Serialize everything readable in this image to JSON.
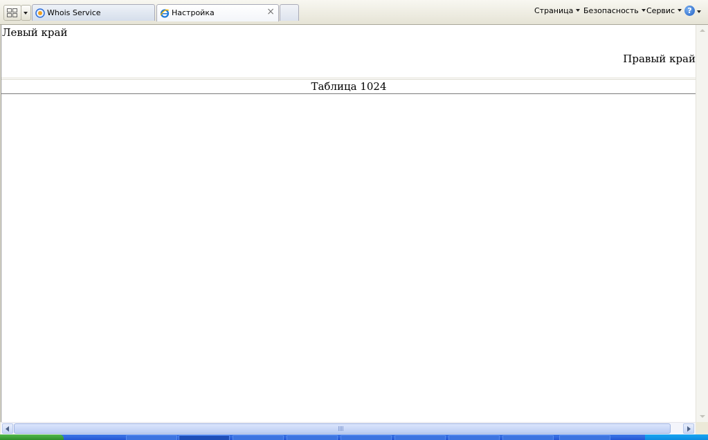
{
  "tabs": [
    {
      "label": "Whois Service",
      "icon": "whois-favicon"
    },
    {
      "label": "Настройка",
      "icon": "ie-favicon",
      "close": "×"
    }
  ],
  "command_bar": {
    "page": "Страница",
    "security": "Безопасность",
    "tools": "Сервис",
    "help": "?"
  },
  "content": {
    "left_edge": "Левый край",
    "right_edge": "Правый край",
    "table_caption": "Таблица 1024"
  },
  "colors": {
    "accent": "#316ac5",
    "page_background": "#ffffff",
    "chrome": "#ece9d8"
  }
}
